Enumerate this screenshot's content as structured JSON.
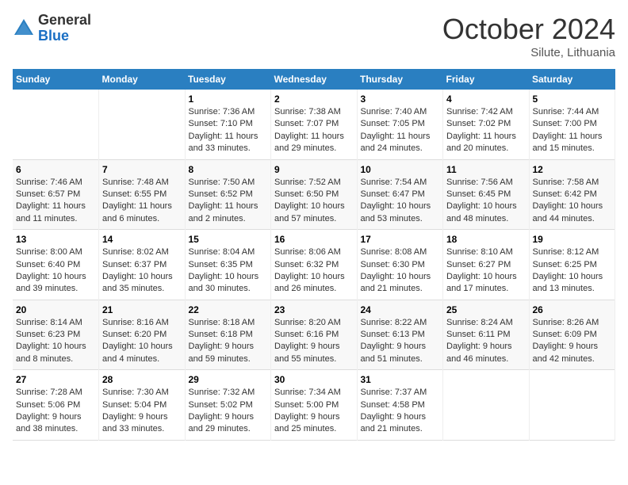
{
  "header": {
    "logo_general": "General",
    "logo_blue": "Blue",
    "month_title": "October 2024",
    "subtitle": "Silute, Lithuania"
  },
  "days_of_week": [
    "Sunday",
    "Monday",
    "Tuesday",
    "Wednesday",
    "Thursday",
    "Friday",
    "Saturday"
  ],
  "weeks": [
    [
      {
        "day": "",
        "info": ""
      },
      {
        "day": "",
        "info": ""
      },
      {
        "day": "1",
        "info": "Sunrise: 7:36 AM\nSunset: 7:10 PM\nDaylight: 11 hours\nand 33 minutes."
      },
      {
        "day": "2",
        "info": "Sunrise: 7:38 AM\nSunset: 7:07 PM\nDaylight: 11 hours\nand 29 minutes."
      },
      {
        "day": "3",
        "info": "Sunrise: 7:40 AM\nSunset: 7:05 PM\nDaylight: 11 hours\nand 24 minutes."
      },
      {
        "day": "4",
        "info": "Sunrise: 7:42 AM\nSunset: 7:02 PM\nDaylight: 11 hours\nand 20 minutes."
      },
      {
        "day": "5",
        "info": "Sunrise: 7:44 AM\nSunset: 7:00 PM\nDaylight: 11 hours\nand 15 minutes."
      }
    ],
    [
      {
        "day": "6",
        "info": "Sunrise: 7:46 AM\nSunset: 6:57 PM\nDaylight: 11 hours\nand 11 minutes."
      },
      {
        "day": "7",
        "info": "Sunrise: 7:48 AM\nSunset: 6:55 PM\nDaylight: 11 hours\nand 6 minutes."
      },
      {
        "day": "8",
        "info": "Sunrise: 7:50 AM\nSunset: 6:52 PM\nDaylight: 11 hours\nand 2 minutes."
      },
      {
        "day": "9",
        "info": "Sunrise: 7:52 AM\nSunset: 6:50 PM\nDaylight: 10 hours\nand 57 minutes."
      },
      {
        "day": "10",
        "info": "Sunrise: 7:54 AM\nSunset: 6:47 PM\nDaylight: 10 hours\nand 53 minutes."
      },
      {
        "day": "11",
        "info": "Sunrise: 7:56 AM\nSunset: 6:45 PM\nDaylight: 10 hours\nand 48 minutes."
      },
      {
        "day": "12",
        "info": "Sunrise: 7:58 AM\nSunset: 6:42 PM\nDaylight: 10 hours\nand 44 minutes."
      }
    ],
    [
      {
        "day": "13",
        "info": "Sunrise: 8:00 AM\nSunset: 6:40 PM\nDaylight: 10 hours\nand 39 minutes."
      },
      {
        "day": "14",
        "info": "Sunrise: 8:02 AM\nSunset: 6:37 PM\nDaylight: 10 hours\nand 35 minutes."
      },
      {
        "day": "15",
        "info": "Sunrise: 8:04 AM\nSunset: 6:35 PM\nDaylight: 10 hours\nand 30 minutes."
      },
      {
        "day": "16",
        "info": "Sunrise: 8:06 AM\nSunset: 6:32 PM\nDaylight: 10 hours\nand 26 minutes."
      },
      {
        "day": "17",
        "info": "Sunrise: 8:08 AM\nSunset: 6:30 PM\nDaylight: 10 hours\nand 21 minutes."
      },
      {
        "day": "18",
        "info": "Sunrise: 8:10 AM\nSunset: 6:27 PM\nDaylight: 10 hours\nand 17 minutes."
      },
      {
        "day": "19",
        "info": "Sunrise: 8:12 AM\nSunset: 6:25 PM\nDaylight: 10 hours\nand 13 minutes."
      }
    ],
    [
      {
        "day": "20",
        "info": "Sunrise: 8:14 AM\nSunset: 6:23 PM\nDaylight: 10 hours\nand 8 minutes."
      },
      {
        "day": "21",
        "info": "Sunrise: 8:16 AM\nSunset: 6:20 PM\nDaylight: 10 hours\nand 4 minutes."
      },
      {
        "day": "22",
        "info": "Sunrise: 8:18 AM\nSunset: 6:18 PM\nDaylight: 9 hours\nand 59 minutes."
      },
      {
        "day": "23",
        "info": "Sunrise: 8:20 AM\nSunset: 6:16 PM\nDaylight: 9 hours\nand 55 minutes."
      },
      {
        "day": "24",
        "info": "Sunrise: 8:22 AM\nSunset: 6:13 PM\nDaylight: 9 hours\nand 51 minutes."
      },
      {
        "day": "25",
        "info": "Sunrise: 8:24 AM\nSunset: 6:11 PM\nDaylight: 9 hours\nand 46 minutes."
      },
      {
        "day": "26",
        "info": "Sunrise: 8:26 AM\nSunset: 6:09 PM\nDaylight: 9 hours\nand 42 minutes."
      }
    ],
    [
      {
        "day": "27",
        "info": "Sunrise: 7:28 AM\nSunset: 5:06 PM\nDaylight: 9 hours\nand 38 minutes."
      },
      {
        "day": "28",
        "info": "Sunrise: 7:30 AM\nSunset: 5:04 PM\nDaylight: 9 hours\nand 33 minutes."
      },
      {
        "day": "29",
        "info": "Sunrise: 7:32 AM\nSunset: 5:02 PM\nDaylight: 9 hours\nand 29 minutes."
      },
      {
        "day": "30",
        "info": "Sunrise: 7:34 AM\nSunset: 5:00 PM\nDaylight: 9 hours\nand 25 minutes."
      },
      {
        "day": "31",
        "info": "Sunrise: 7:37 AM\nSunset: 4:58 PM\nDaylight: 9 hours\nand 21 minutes."
      },
      {
        "day": "",
        "info": ""
      },
      {
        "day": "",
        "info": ""
      }
    ]
  ]
}
